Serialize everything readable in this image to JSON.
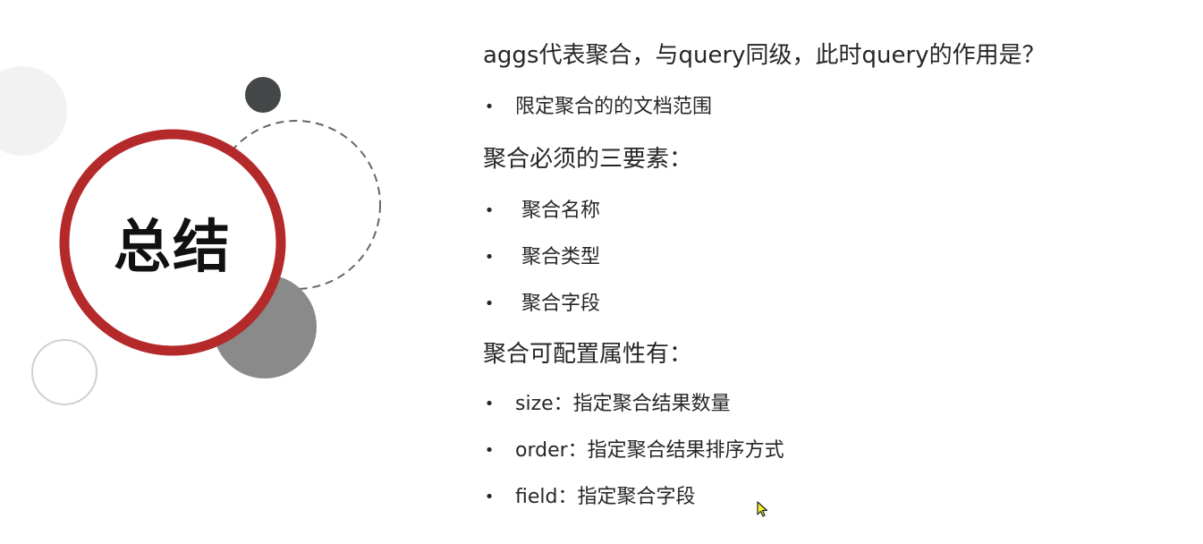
{
  "summary_badge": {
    "title": "总结"
  },
  "section_query": {
    "heading": "aggs代表聚合，与query同级，此时query的作用是？",
    "items": [
      {
        "text": "限定聚合的的文档范围"
      }
    ]
  },
  "section_required": {
    "heading": "聚合必须的三要素：",
    "items": [
      {
        "text": "聚合名称"
      },
      {
        "text": "聚合类型"
      },
      {
        "text": "聚合字段"
      }
    ]
  },
  "section_config": {
    "heading": "聚合可配置属性有：",
    "items": [
      {
        "text": "size：指定聚合结果数量"
      },
      {
        "text": "order：指定聚合结果排序方式"
      },
      {
        "text": "field：指定聚合字段"
      }
    ]
  },
  "bullet_symbol": "•",
  "colors": {
    "ring_red": "#b42a2a",
    "dark_dot": "#454848",
    "gray_circle": "#8a8a8a",
    "light_circle": "#f2f2f2",
    "dashed_ring": "#666666"
  }
}
